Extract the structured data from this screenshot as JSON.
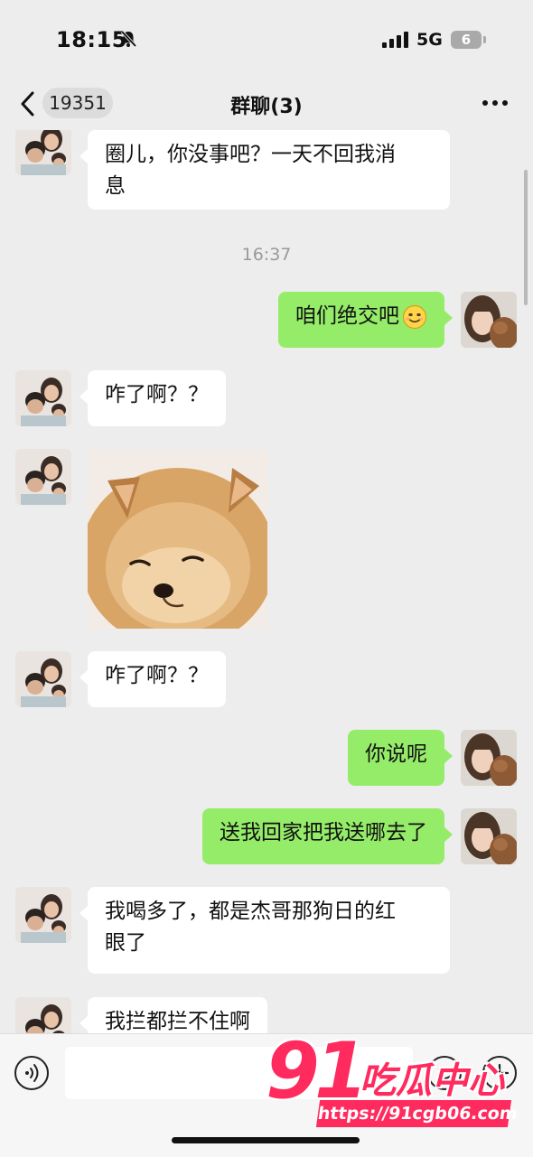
{
  "status_bar": {
    "time": "18:15",
    "network": "5G",
    "battery": "6"
  },
  "nav": {
    "unread_count": "19351",
    "title": "群聊(3)"
  },
  "messages": [
    {
      "side": "left",
      "text_line1": "圈儿，你没事吧？一天不回我消",
      "text_line2": "息"
    },
    {
      "type": "time",
      "text": "16:37"
    },
    {
      "side": "right",
      "text": "咱们绝交吧",
      "emoji": "smile"
    },
    {
      "side": "left",
      "text": "咋了啊？？"
    },
    {
      "side": "left",
      "type": "image",
      "image": "pomeranian-dog-sticker"
    },
    {
      "side": "left",
      "text": "咋了啊？？"
    },
    {
      "side": "right",
      "text": "你说呢"
    },
    {
      "side": "right",
      "text": "送我回家把我送哪去了"
    },
    {
      "side": "left",
      "text_line1": "我喝多了，都是杰哥那狗日的红",
      "text_line2": "眼了"
    },
    {
      "side": "left",
      "text": "我拦都拦不住啊"
    }
  ],
  "input": {
    "placeholder": ""
  },
  "watermark": {
    "number": "91",
    "name": "吃瓜中心",
    "url": "https://91cgb06.com"
  },
  "colors": {
    "sent_bubble": "#95ec69",
    "received_bubble": "#ffffff",
    "background": "#ededed",
    "watermark": "#ff2a5d"
  }
}
